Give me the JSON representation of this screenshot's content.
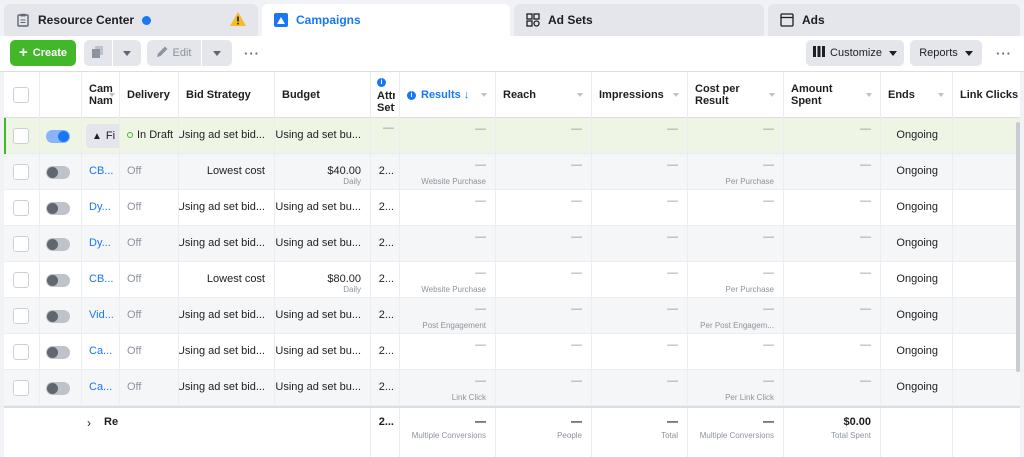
{
  "tabs": [
    {
      "label": "Resource Center",
      "icon": "clipboard-icon"
    },
    {
      "label": "Campaigns",
      "icon": "campaign-icon"
    },
    {
      "label": "Ad Sets",
      "icon": "grid-icon"
    },
    {
      "label": "Ads",
      "icon": "ad-icon"
    }
  ],
  "toolbar": {
    "create_label": "Create",
    "edit_label": "Edit",
    "customize_label": "Customize",
    "reports_label": "Reports",
    "more_label": "···"
  },
  "columns": {
    "name": "Campaign Name",
    "delivery": "Delivery",
    "bid_strategy": "Bid Strategy",
    "budget": "Budget",
    "attribution": "Attribution Setting",
    "results": "Results",
    "reach": "Reach",
    "impressions": "Impressions",
    "cost_per_result": "Cost per Result",
    "amount_spent": "Amount Spent",
    "ends": "Ends",
    "link_clicks": "Link Clicks"
  },
  "rows": [
    {
      "toggle": true,
      "name": "Fi",
      "delivery": "In Draft",
      "bid": "Using ad set bid...",
      "budget": "Using ad set bu...",
      "budget_sub": "",
      "attr": "—",
      "results": "—",
      "results_sub": "",
      "reach": "—",
      "impressions": "—",
      "cpr": "—",
      "cpr_sub": "",
      "spent": "—",
      "ends": "Ongoing"
    },
    {
      "toggle": false,
      "name": "CB...",
      "delivery": "Off",
      "bid": "Lowest cost",
      "budget": "$40.00",
      "budget_sub": "Daily",
      "attr": "2...",
      "results": "—",
      "results_sub": "Website Purchase",
      "reach": "—",
      "impressions": "—",
      "cpr": "—",
      "cpr_sub": "Per Purchase",
      "spent": "—",
      "ends": "Ongoing"
    },
    {
      "toggle": false,
      "name": "Dy...",
      "delivery": "Off",
      "bid": "Using ad set bid...",
      "budget": "Using ad set bu...",
      "budget_sub": "",
      "attr": "2...",
      "results": "—",
      "results_sub": "",
      "reach": "—",
      "impressions": "—",
      "cpr": "—",
      "cpr_sub": "",
      "spent": "—",
      "ends": "Ongoing"
    },
    {
      "toggle": false,
      "name": "Dy...",
      "delivery": "Off",
      "bid": "Using ad set bid...",
      "budget": "Using ad set bu...",
      "budget_sub": "",
      "attr": "2...",
      "results": "—",
      "results_sub": "",
      "reach": "—",
      "impressions": "—",
      "cpr": "—",
      "cpr_sub": "",
      "spent": "—",
      "ends": "Ongoing"
    },
    {
      "toggle": false,
      "name": "CB...",
      "delivery": "Off",
      "bid": "Lowest cost",
      "budget": "$80.00",
      "budget_sub": "Daily",
      "attr": "2...",
      "results": "—",
      "results_sub": "Website Purchase",
      "reach": "—",
      "impressions": "—",
      "cpr": "—",
      "cpr_sub": "Per Purchase",
      "spent": "—",
      "ends": "Ongoing"
    },
    {
      "toggle": false,
      "name": "Vid...",
      "delivery": "Off",
      "bid": "Using ad set bid...",
      "budget": "Using ad set bu...",
      "budget_sub": "",
      "attr": "2...",
      "results": "—",
      "results_sub": "Post Engagement",
      "reach": "—",
      "impressions": "—",
      "cpr": "—",
      "cpr_sub": "Per Post Engagem...",
      "spent": "—",
      "ends": "Ongoing"
    },
    {
      "toggle": false,
      "name": "Ca...",
      "delivery": "Off",
      "bid": "Using ad set bid...",
      "budget": "Using ad set bu...",
      "budget_sub": "",
      "attr": "2...",
      "results": "—",
      "results_sub": "",
      "reach": "—",
      "impressions": "—",
      "cpr": "—",
      "cpr_sub": "",
      "spent": "—",
      "ends": "Ongoing"
    },
    {
      "toggle": false,
      "name": "Ca...",
      "delivery": "Off",
      "bid": "Using ad set bid...",
      "budget": "Using ad set bu...",
      "budget_sub": "",
      "attr": "2...",
      "results": "—",
      "results_sub": "Link Click",
      "reach": "—",
      "impressions": "—",
      "cpr": "—",
      "cpr_sub": "Per Link Click",
      "spent": "—",
      "ends": "Ongoing"
    }
  ],
  "footer": {
    "label": "Re",
    "attr": "2...",
    "results": "—",
    "results_sub": "Multiple Conversions",
    "reach": "—",
    "reach_sub": "People",
    "impressions": "—",
    "impressions_sub": "Total",
    "cpr": "—",
    "cpr_sub": "Multiple Conversions",
    "spent": "$0.00",
    "spent_sub": "Total Spent"
  },
  "colors": {
    "accent": "#1877f2",
    "create": "#42b72a",
    "warning": "#f7b928"
  }
}
